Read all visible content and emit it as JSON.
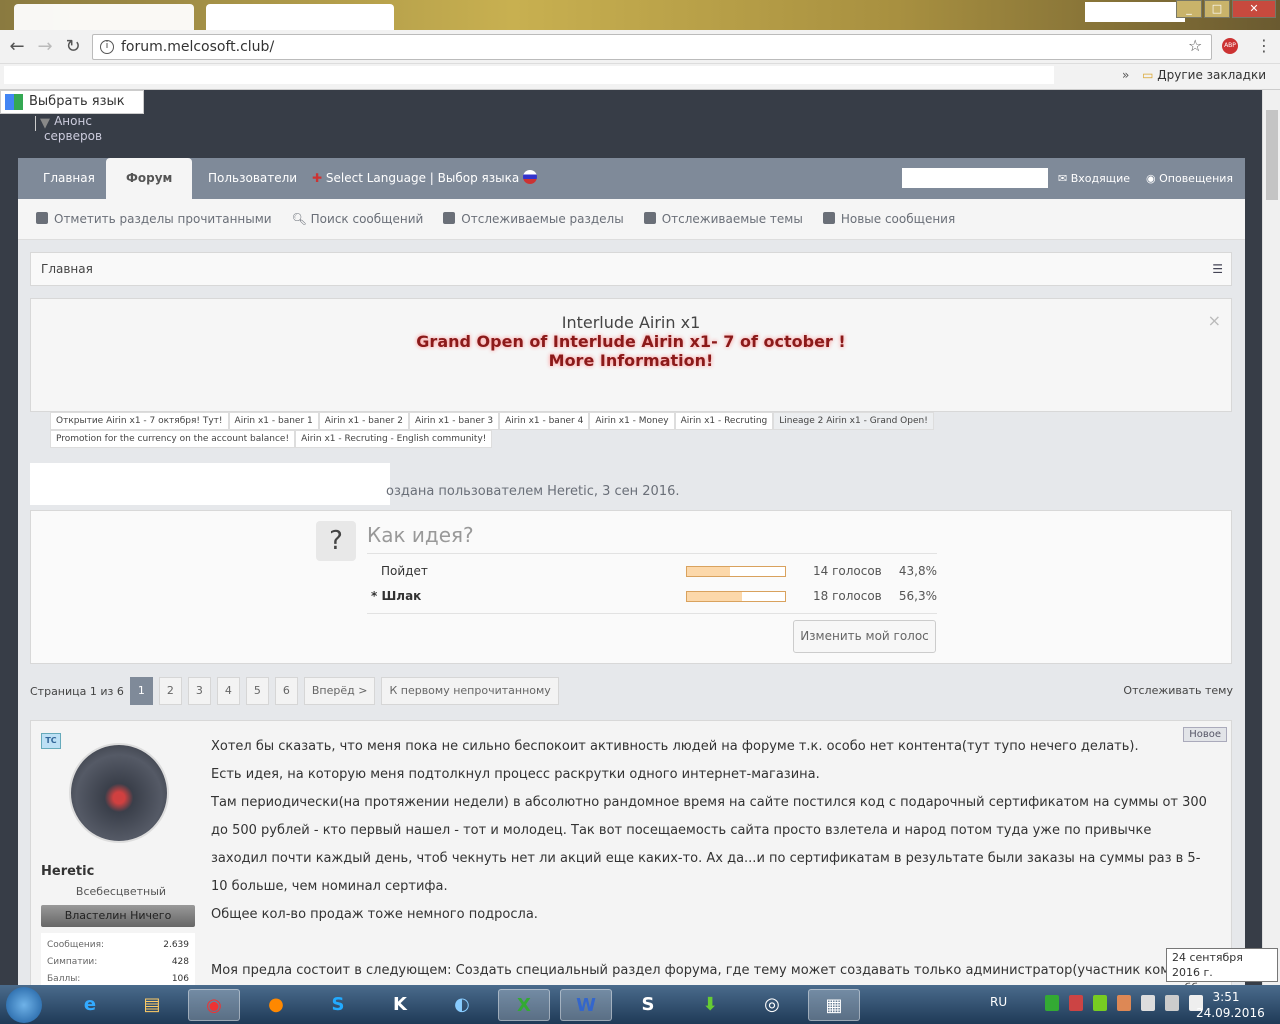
{
  "browser": {
    "url": "forum.melcosoft.club/",
    "other_bookmarks": "Другие закладки",
    "more": "»"
  },
  "translate": {
    "label": "Выбрать язык",
    "arrow": "▼"
  },
  "anons": "Анонс серверов",
  "nav": {
    "tabs": [
      "Главная",
      "Форум",
      "Пользователи",
      "Select Language | Выбор языка"
    ],
    "inbox": "Входящие",
    "alerts": "Оповещения"
  },
  "subnav": [
    "Отметить разделы прочитанными",
    "Поиск сообщений",
    "Отслеживаемые разделы",
    "Отслеживаемые темы",
    "Новые сообщения"
  ],
  "breadcrumb": "Главная",
  "notice": {
    "title": "Interlude Airin x1",
    "line2": "Grand Open of Interlude Airin x1- 7 of october !",
    "line3": "More Information!",
    "close": "×",
    "tabs": [
      "Открытие Airin x1 - 7 октября! Тут!",
      "Airin x1 - baner 1",
      "Airin x1 - baner 2",
      "Airin x1 - baner 3",
      "Airin x1 - baner 4",
      "Airin x1 - Money",
      "Airin x1 - Recruting",
      "Lineage 2 Airin x1 - Grand Open!",
      "Promotion for the currency on the account balance!",
      "Airin x1 - Recruting - English community!"
    ]
  },
  "thread_info": "оздана пользователем Heretic, 3 сен 2016.",
  "poll": {
    "icon": "?",
    "question": "Как идея?",
    "options": [
      {
        "label": "Пойдет",
        "votes": "14 голосов",
        "percent": "43,8%",
        "fraction": 0.438
      },
      {
        "label": "* Шлак",
        "votes": "18 голосов",
        "percent": "56,3%",
        "fraction": 0.563
      }
    ],
    "change_vote": "Изменить мой голос"
  },
  "pagination": {
    "label": "Страница 1 из 6",
    "pages": [
      "1",
      "2",
      "3",
      "4",
      "5",
      "6"
    ],
    "next": "Вперёд >",
    "first_unread": "К первому непрочитанному",
    "watch": "Отслеживать тему"
  },
  "post": {
    "badge": "TC",
    "new": "Новое",
    "user": "Heretic",
    "user_title": "Всебесцветный",
    "rank": "Властелин Ничего",
    "stats": [
      {
        "k": "Сообщения:",
        "v": "2.639"
      },
      {
        "k": "Симпатии:",
        "v": "428"
      },
      {
        "k": "Баллы:",
        "v": "106"
      }
    ],
    "paragraphs": [
      "Хотел бы сказать, что меня пока не сильно беспокоит активность людей на форуме т.к. особо нет контента(тут тупо нечего делать).",
      "Есть идея, на которую меня подтолкнул процесс раскрутки одного интернет-магазина.",
      "Там периодически(на протяжении недели) в абсолютно рандомное время на сайте постился код с подарочный сертификатом на суммы от 300 до 500 рублей - кто первый нашел - тот и молодец. Так вот посещаемость сайта просто взлетела и народ потом туда уже по привычке заходил почти каждый день, чтоб чекнуть нет ли акций еще каких-то. Ах да...и по сертификатам в результате были заказы на суммы раз в 5-10 больше, чем номинал сертифа.",
      "Общее кол-во продаж тоже немного подросла.",
      "",
      "Моя предла состоит в следующем: Создать специальный раздел форума, где тему может создавать только администратор(участник команды) и на протяжении некоторого времени(до 1ого октября) создавать в этом разделе тему, которая будет содержать только одну фразу.... Например:"
    ]
  },
  "tooltip": {
    "date": "24 сентября 2016 г.",
    "day": "суббота"
  },
  "taskbar": {
    "lang": "RU",
    "time": "3:51",
    "date": "24.09.2016"
  }
}
